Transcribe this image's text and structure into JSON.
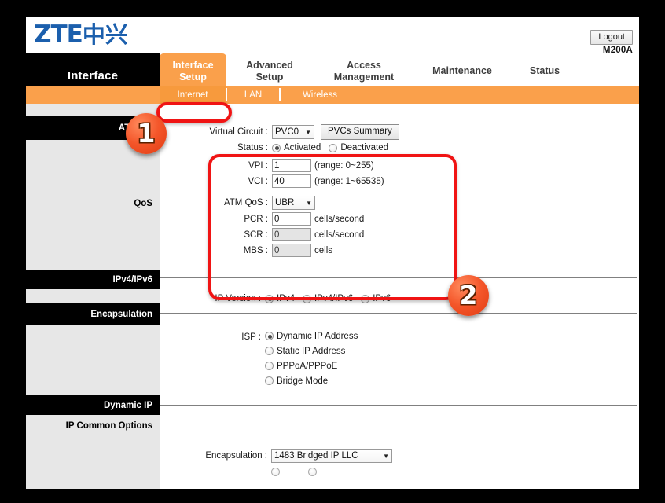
{
  "brand": {
    "name": "ZTE",
    "cn": "中兴"
  },
  "header": {
    "logout_label": "Logout",
    "model": "M200A"
  },
  "nav": {
    "section_title": "Interface",
    "tabs": [
      {
        "label": "Interface\nSetup",
        "active": true
      },
      {
        "label": "Advanced\nSetup",
        "active": false
      },
      {
        "label": "Access\nManagement",
        "active": false
      },
      {
        "label": "Maintenance",
        "active": false
      },
      {
        "label": "Status",
        "active": false
      }
    ],
    "subtabs": [
      {
        "label": "Internet",
        "active": true
      },
      {
        "label": "LAN",
        "active": false
      },
      {
        "label": "Wireless",
        "active": false
      }
    ]
  },
  "sidebar": {
    "items": [
      {
        "label": "ATM VC",
        "style": "black"
      },
      {
        "label": "QoS",
        "style": "plain"
      },
      {
        "label": "IPv4/IPv6",
        "style": "black"
      },
      {
        "label": "Encapsulation",
        "style": "black"
      },
      {
        "label": "Dynamic IP",
        "style": "black"
      },
      {
        "label": "IP Common Options",
        "style": "plain"
      }
    ]
  },
  "form": {
    "virtual_circuit": {
      "label": "Virtual Circuit :",
      "value": "PVC0",
      "summary_button": "PVCs Summary"
    },
    "status": {
      "label": "Status :",
      "options": [
        {
          "label": "Activated",
          "selected": true
        },
        {
          "label": "Deactivated",
          "selected": false
        }
      ]
    },
    "vpi": {
      "label": "VPI :",
      "value": "1",
      "hint": "(range: 0~255)"
    },
    "vci": {
      "label": "VCI :",
      "value": "40",
      "hint": "(range: 1~65535)"
    },
    "atm_qos": {
      "label": "ATM QoS :",
      "value": "UBR"
    },
    "pcr": {
      "label": "PCR :",
      "value": "0",
      "unit": "cells/second",
      "disabled": false
    },
    "scr": {
      "label": "SCR :",
      "value": "0",
      "unit": "cells/second",
      "disabled": true
    },
    "mbs": {
      "label": "MBS :",
      "value": "0",
      "unit": "cells",
      "disabled": true
    },
    "ip_version": {
      "label": "IP Version :",
      "options": [
        {
          "label": "IPv4",
          "selected": true
        },
        {
          "label": "IPv4/IPv6",
          "selected": false
        },
        {
          "label": "IPv6",
          "selected": false
        }
      ]
    },
    "isp": {
      "label": "ISP :",
      "options": [
        {
          "label": "Dynamic IP Address",
          "selected": true
        },
        {
          "label": "Static IP Address",
          "selected": false
        },
        {
          "label": "PPPoA/PPPoE",
          "selected": false
        },
        {
          "label": "Bridge Mode",
          "selected": false
        }
      ]
    },
    "encapsulation": {
      "label": "Encapsulation :",
      "value": "1483 Bridged IP LLC"
    }
  },
  "annotations": {
    "badge_one": "1",
    "badge_two": "2"
  },
  "colors": {
    "accent_orange": "#faa04b",
    "subnav_active": "#f79a3d",
    "highlight_red": "#f01414",
    "sidebar_bg": "#e7e7e7",
    "brand_blue": "#1b5fad"
  }
}
